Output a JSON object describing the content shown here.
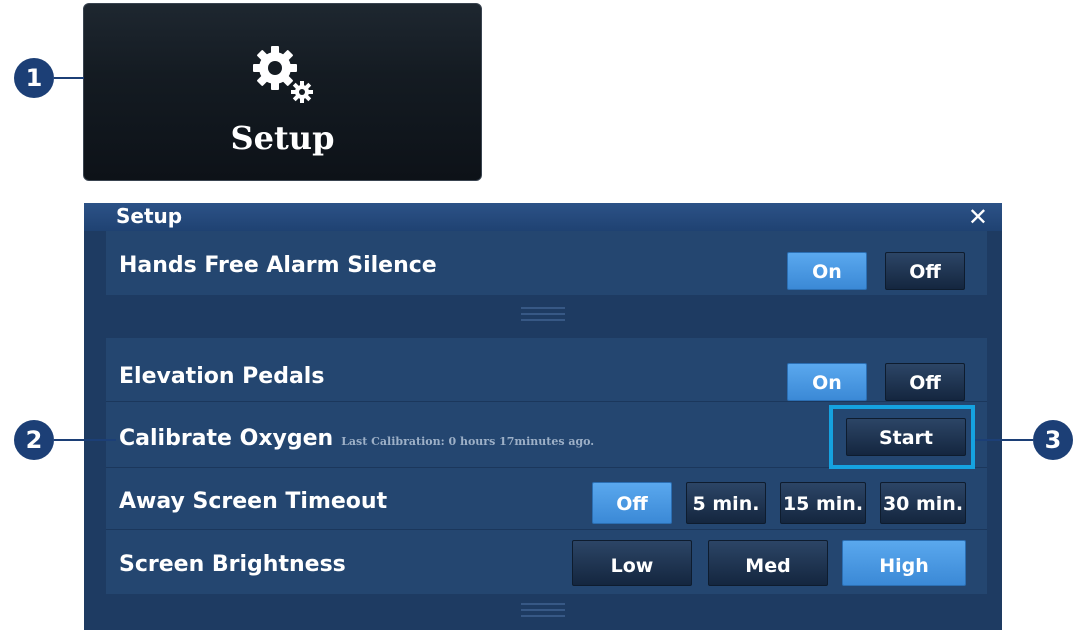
{
  "launcher": {
    "label": "Setup",
    "icon": "gear-icon"
  },
  "callouts": {
    "one": "1",
    "two": "2",
    "three": "3"
  },
  "dialog": {
    "title": "Setup",
    "close_icon": "✕",
    "hands_free": {
      "label": "Hands Free Alarm Silence",
      "on": "On",
      "off": "Off",
      "selected": "On"
    },
    "elevation": {
      "label": "Elevation Pedals",
      "on": "On",
      "off": "Off",
      "selected": "On"
    },
    "oxygen": {
      "label": "Calibrate Oxygen",
      "sub": "Last Calibration: 0 hours 17minutes ago.",
      "start": "Start"
    },
    "away": {
      "label": "Away Screen Timeout",
      "options": [
        "Off",
        "5 min.",
        "15 min.",
        "30 min."
      ],
      "selected": "Off"
    },
    "brightness": {
      "label": "Screen Brightness",
      "options": [
        "Low",
        "Med",
        "High"
      ],
      "selected": "High"
    }
  },
  "colors": {
    "selected_button": "#4a99e3",
    "dialog_bg": "#1e3b62",
    "callout": "#1c3f76",
    "highlight": "#15a2e0"
  }
}
